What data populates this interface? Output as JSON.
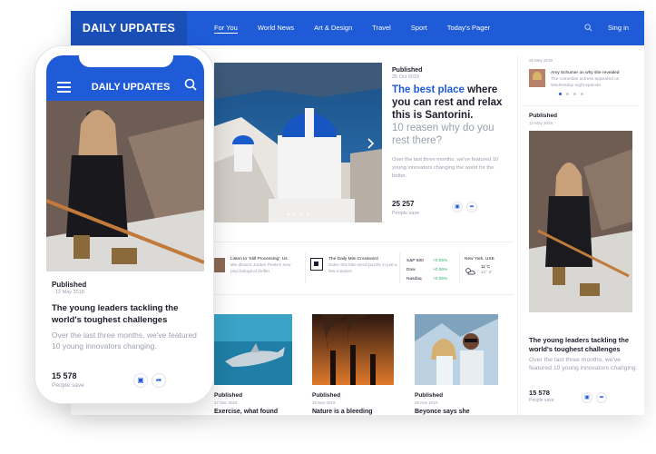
{
  "colors": {
    "brand": "#1f5bd6",
    "brand_dark": "#1b4fb8",
    "muted": "#9aa0ae",
    "positive": "#30b070"
  },
  "desktop": {
    "brand": "DAILY UPDATES",
    "nav": [
      "For You",
      "World News",
      "Art & Design",
      "Travel",
      "Sport",
      "Today's Pager"
    ],
    "signin": "Sing in",
    "hero": {
      "published": "Published",
      "date": "25 Oct 2019",
      "title_highlight": "The best place",
      "title_rest": " where you can rest and relax this is Santorini.",
      "subtitle": "10 reasen why do you rest there?",
      "description": "Over the last three months, we've featured 10 young innovators changing the world for the better.",
      "count": "25 257",
      "count_label": "People save"
    },
    "sidebar": {
      "top_date": "25 May 2019",
      "mini_author": "Amy Schumer on why she revealed",
      "mini_text": "The comedian actress appeared on Wednesday night episode",
      "published": "Published",
      "date": "12 May 2019",
      "title": "The young leaders tackling the world's toughest challenges",
      "description": "Over the last three months, we've featured 10 young innovators changing.",
      "count": "15 578",
      "count_label": "People save"
    },
    "strip": {
      "item1_title": "Listen to 'Still Processing': Us",
      "item1_text": "We dissect Jordan Peele's new psychological thriller",
      "item2_title": "The Daily Mini Crossword",
      "item2_text": "Solve this bite-sized puzzle in just a few minutes",
      "stocks": [
        {
          "name": "S&P 500",
          "value": "+0.05%"
        },
        {
          "name": "Dow",
          "value": "+0.06%"
        },
        {
          "name": "Nasdaq",
          "value": "+0.05%"
        }
      ],
      "weather_city": "New York, USE",
      "weather_temp": "11°C",
      "weather_range": "12° 6°"
    },
    "cards": [
      {
        "published": "Published",
        "date": "17 Dec 2018",
        "title": "Exercise, what found"
      },
      {
        "published": "Published",
        "date": "26 Nov 2019",
        "title": "Nature is a bleeding"
      },
      {
        "published": "Published",
        "date": "26 Nov 2019",
        "title": "Beyonce says she"
      }
    ]
  },
  "phone": {
    "brand": "DAILY UPDATES",
    "published": "Published",
    "date": "12 May 2018",
    "title": "The young leaders tackling the world's toughest challenges",
    "description": "Over the last three months, we've featured 10 young innovators changing.",
    "count": "15 578",
    "count_label": "People save"
  }
}
